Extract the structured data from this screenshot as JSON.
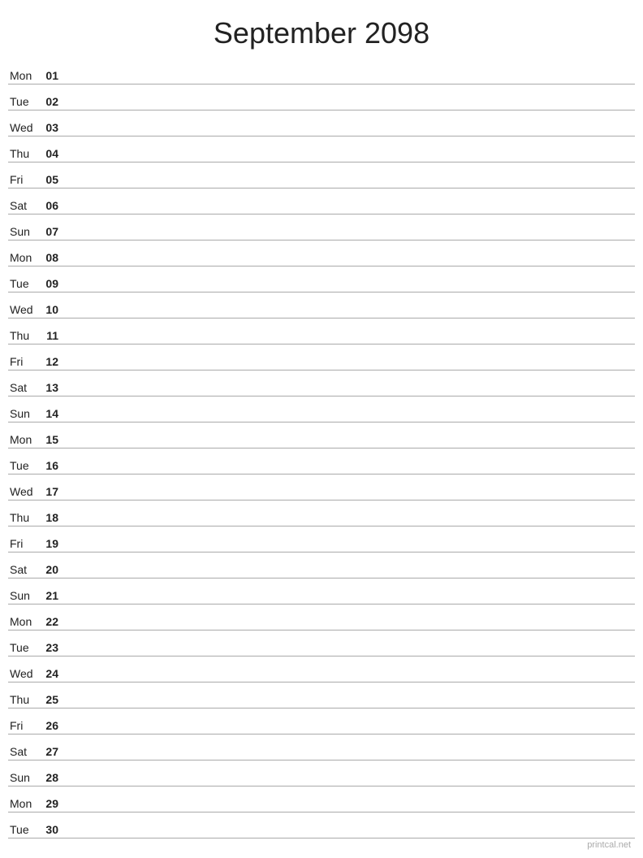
{
  "title": "September 2098",
  "watermark": "printcal.net",
  "days": [
    {
      "name": "Mon",
      "number": "01"
    },
    {
      "name": "Tue",
      "number": "02"
    },
    {
      "name": "Wed",
      "number": "03"
    },
    {
      "name": "Thu",
      "number": "04"
    },
    {
      "name": "Fri",
      "number": "05"
    },
    {
      "name": "Sat",
      "number": "06"
    },
    {
      "name": "Sun",
      "number": "07"
    },
    {
      "name": "Mon",
      "number": "08"
    },
    {
      "name": "Tue",
      "number": "09"
    },
    {
      "name": "Wed",
      "number": "10"
    },
    {
      "name": "Thu",
      "number": "11"
    },
    {
      "name": "Fri",
      "number": "12"
    },
    {
      "name": "Sat",
      "number": "13"
    },
    {
      "name": "Sun",
      "number": "14"
    },
    {
      "name": "Mon",
      "number": "15"
    },
    {
      "name": "Tue",
      "number": "16"
    },
    {
      "name": "Wed",
      "number": "17"
    },
    {
      "name": "Thu",
      "number": "18"
    },
    {
      "name": "Fri",
      "number": "19"
    },
    {
      "name": "Sat",
      "number": "20"
    },
    {
      "name": "Sun",
      "number": "21"
    },
    {
      "name": "Mon",
      "number": "22"
    },
    {
      "name": "Tue",
      "number": "23"
    },
    {
      "name": "Wed",
      "number": "24"
    },
    {
      "name": "Thu",
      "number": "25"
    },
    {
      "name": "Fri",
      "number": "26"
    },
    {
      "name": "Sat",
      "number": "27"
    },
    {
      "name": "Sun",
      "number": "28"
    },
    {
      "name": "Mon",
      "number": "29"
    },
    {
      "name": "Tue",
      "number": "30"
    }
  ]
}
